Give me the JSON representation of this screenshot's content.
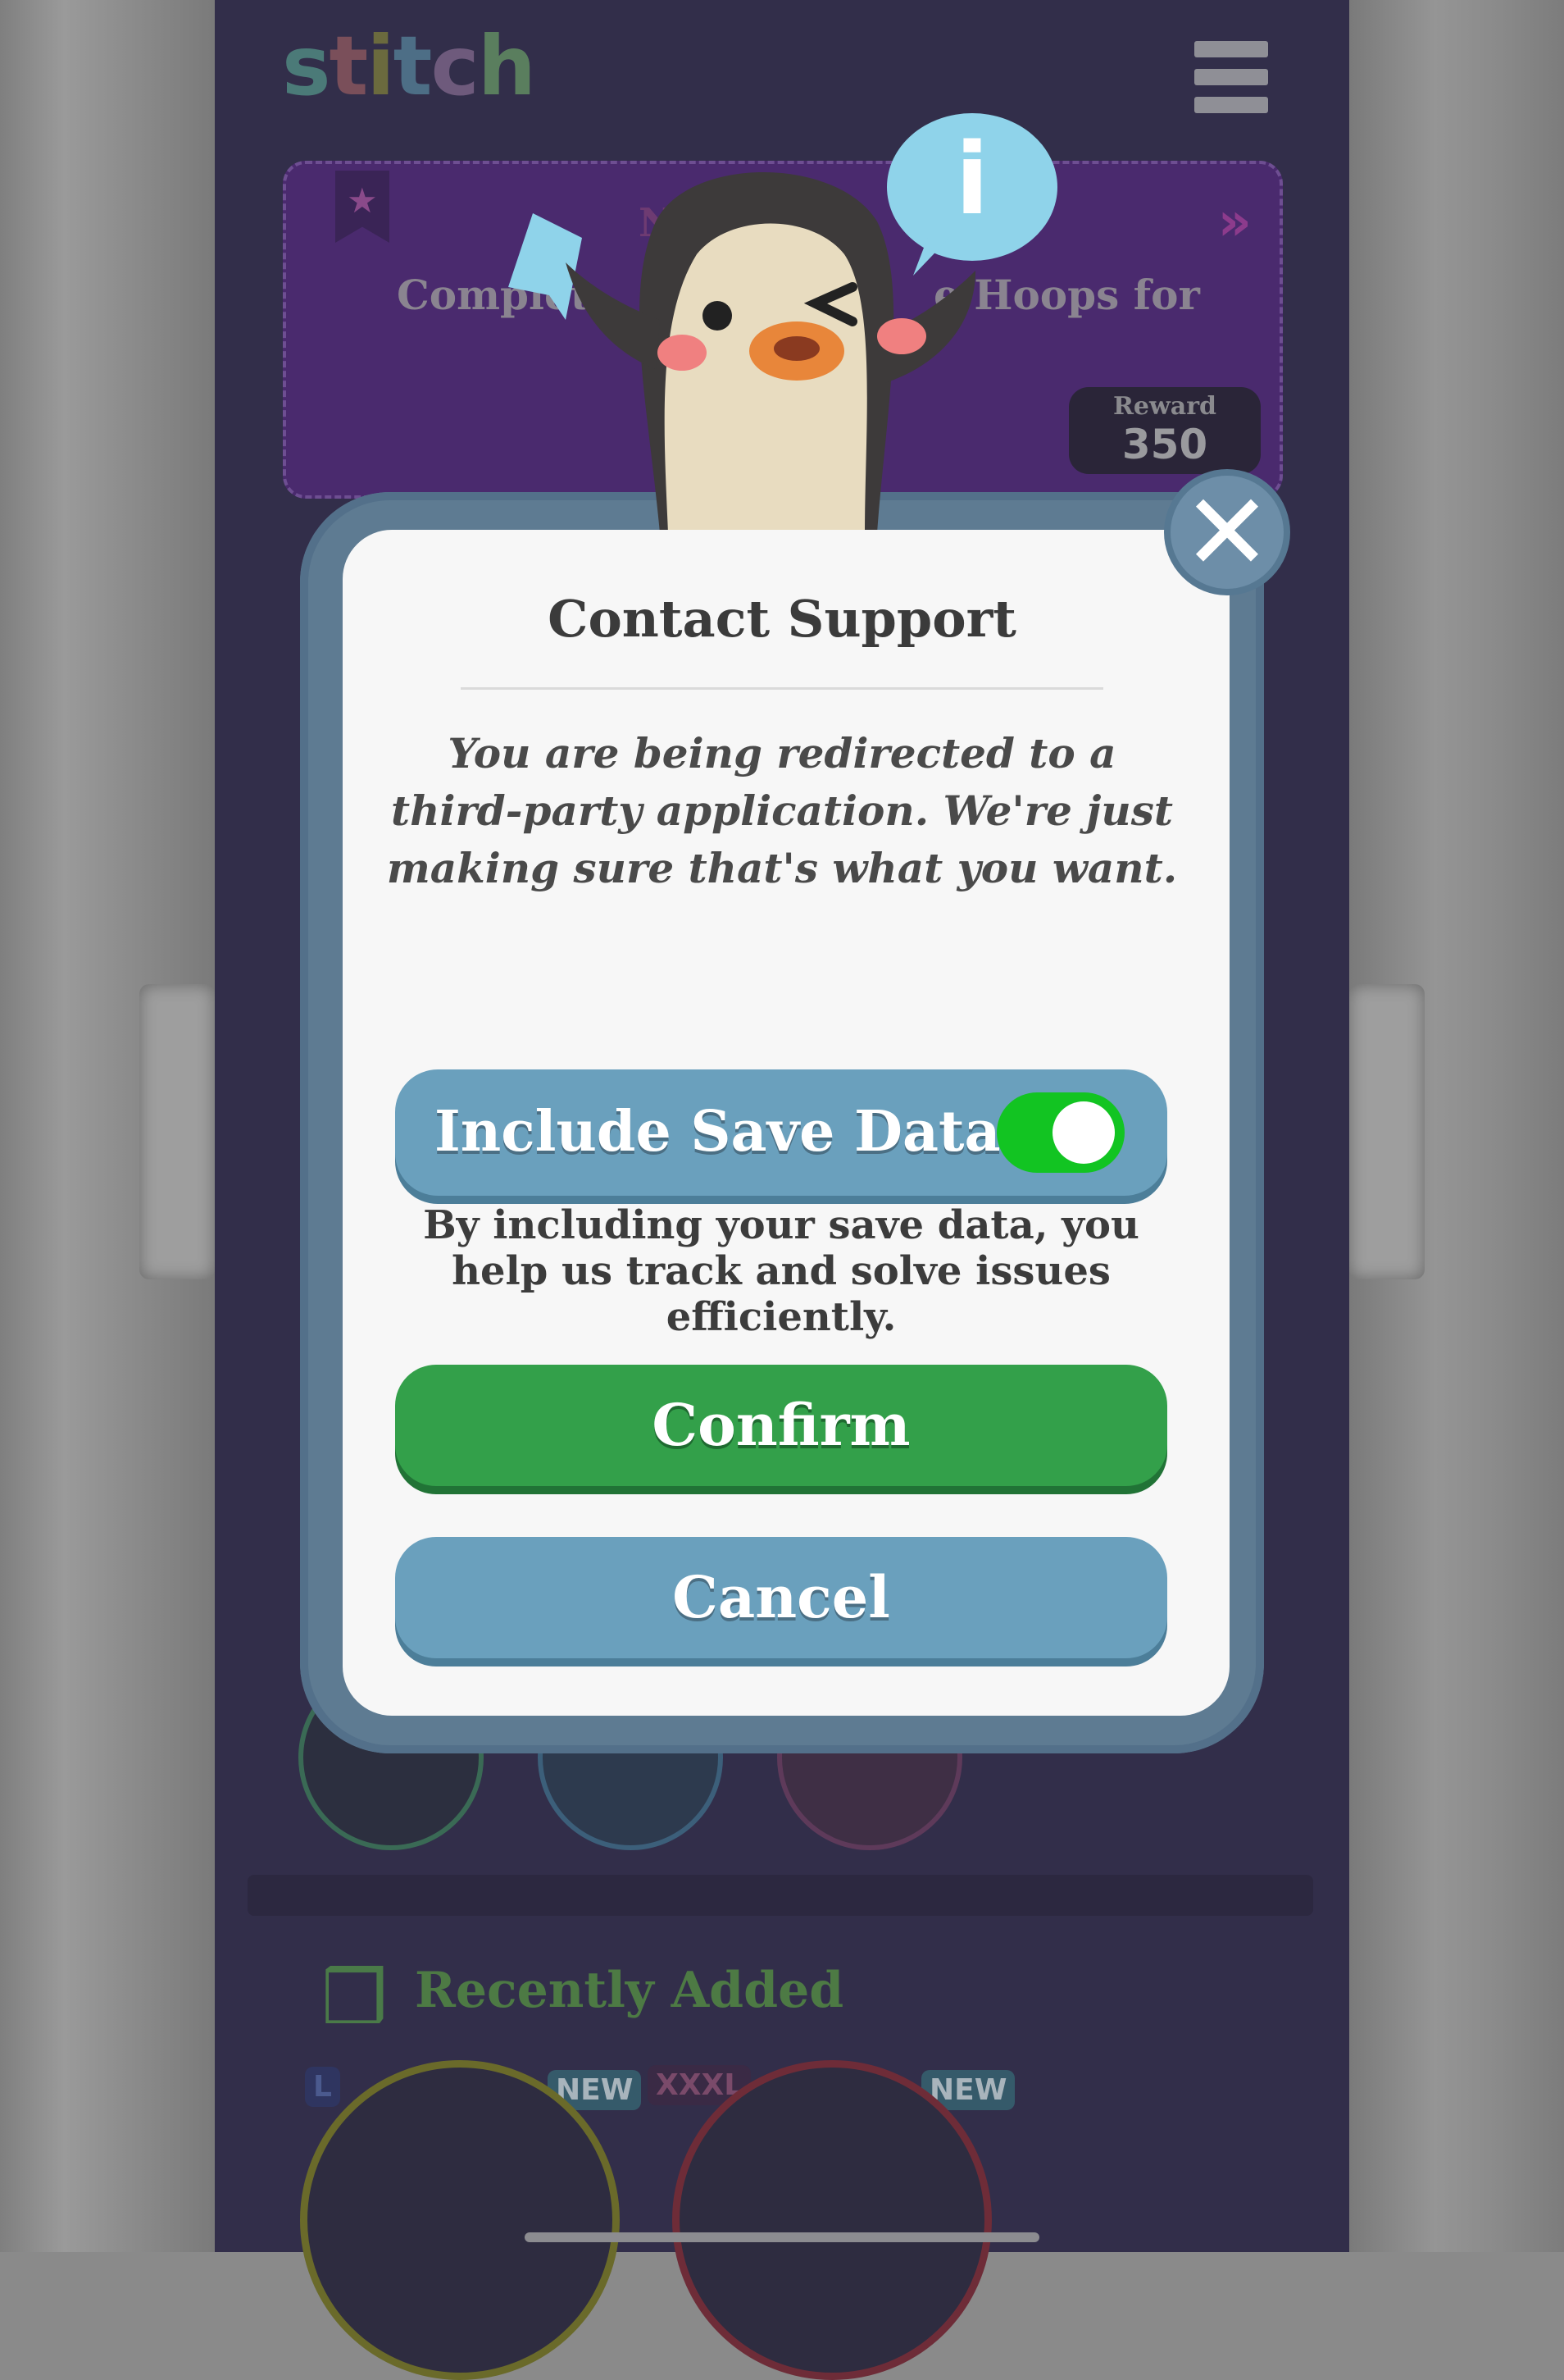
{
  "app": {
    "logo_text": "stitch"
  },
  "quest": {
    "title": "Ne",
    "text_left": "Complet",
    "text_right": "e Hoops for",
    "reward_label": "Reward",
    "reward_value": "350"
  },
  "modal": {
    "title": "Contact Support",
    "message": "You are being redirected to a third-party application. We're just making sure that's what you want.",
    "toggle_label": "Include Save Data",
    "toggle_on": true,
    "save_note": "By including your save data, you help us track and solve issues efficiently.",
    "confirm_label": "Confirm",
    "cancel_label": "Cancel"
  },
  "recent": {
    "title": "Recently Added",
    "tags": [
      "L",
      "NEW",
      "XXXL",
      "NEW"
    ]
  },
  "icons": {
    "close": "close-icon",
    "menu": "hamburger-menu-icon",
    "info": "info-bubble-icon",
    "mascot": "penguin-mascot"
  },
  "colors": {
    "confirm": "#33a04a",
    "cancel": "#6aa0bd",
    "toggle_on": "#12c422",
    "recent_title": "#4d7a44"
  }
}
